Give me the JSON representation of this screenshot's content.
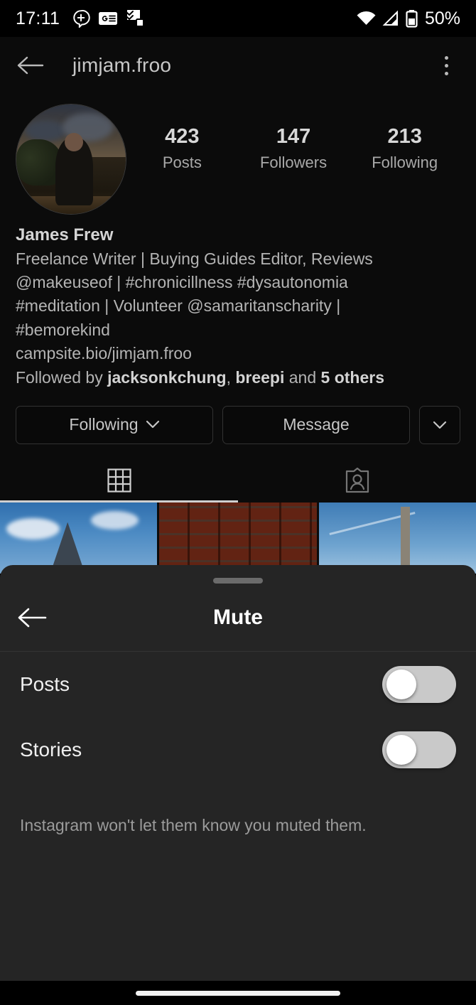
{
  "status_bar": {
    "time": "17:11",
    "left_icons": [
      "message-plus-icon",
      "news-card-icon",
      "tasks-icon"
    ],
    "right_icons": [
      "wifi-icon",
      "cellular-signal-icon",
      "battery-icon"
    ],
    "battery_percent": "50%"
  },
  "app_bar": {
    "back_icon": "back-arrow-icon",
    "title": "jimjam.froo",
    "overflow_icon": "kebab-menu-icon"
  },
  "profile": {
    "avatar_alt": "profile-photo",
    "stats": [
      {
        "value": "423",
        "label": "Posts"
      },
      {
        "value": "147",
        "label": "Followers"
      },
      {
        "value": "213",
        "label": "Following"
      }
    ],
    "display_name": "James Frew",
    "bio_lines": [
      "Freelance Writer | Buying Guides Editor, Reviews",
      "@makeuseof | #chronicillness #dysautonomia",
      "#meditation | Volunteer @samaritanscharity |",
      "#bemorekind"
    ],
    "website": "campsite.bio/jimjam.froo",
    "followed_by": {
      "prefix": "Followed by ",
      "user1": "jacksonkchung",
      "sep1": ", ",
      "user2": "breepi",
      "sep2": " and ",
      "others": "5 others"
    },
    "buttons": {
      "following": "Following",
      "following_chevron": "chevron-down-icon",
      "message": "Message",
      "more_chevron": "chevron-down-icon"
    },
    "tabs": [
      {
        "name": "grid-tab",
        "icon": "grid-icon",
        "active": true
      },
      {
        "name": "tagged-tab",
        "icon": "tagged-person-icon",
        "active": false
      }
    ],
    "grid_photos": [
      {
        "name": "photo-mountain-sky"
      },
      {
        "name": "photo-brick-wall"
      },
      {
        "name": "photo-chimney-sky"
      }
    ]
  },
  "mute_sheet": {
    "handle": "drag-handle",
    "back_icon": "back-arrow-icon",
    "title": "Mute",
    "rows": [
      {
        "label": "Posts",
        "toggle_on": false
      },
      {
        "label": "Stories",
        "toggle_on": false
      }
    ],
    "note": "Instagram won't let them know you muted them."
  },
  "nav_bar": {
    "home_indicator": "home-indicator"
  }
}
